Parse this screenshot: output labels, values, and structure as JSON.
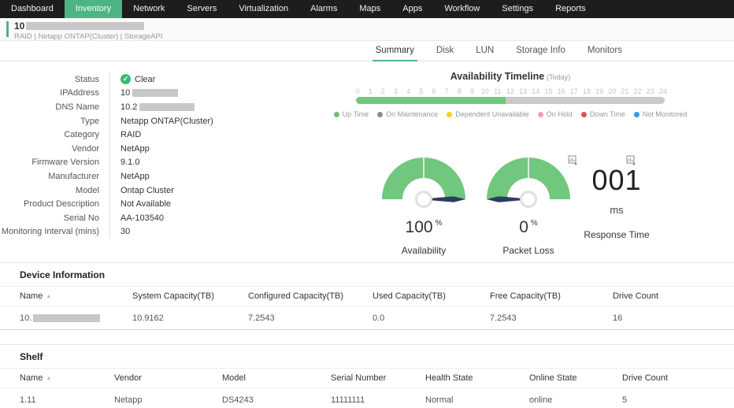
{
  "nav": {
    "items": [
      {
        "label": "Dashboard"
      },
      {
        "label": "Inventory"
      },
      {
        "label": "Network"
      },
      {
        "label": "Servers"
      },
      {
        "label": "Virtualization"
      },
      {
        "label": "Alarms"
      },
      {
        "label": "Maps"
      },
      {
        "label": "Apps"
      },
      {
        "label": "Workflow"
      },
      {
        "label": "Settings"
      },
      {
        "label": "Reports"
      }
    ]
  },
  "header": {
    "title_prefix": "10",
    "subtitle": "RAID | Netapp ONTAP(Cluster)  | StorageAPI"
  },
  "tabs": {
    "items": [
      {
        "label": "Summary",
        "active": true
      },
      {
        "label": "Disk",
        "active": false
      },
      {
        "label": "LUN",
        "active": false
      },
      {
        "label": "Storage Info",
        "active": false
      },
      {
        "label": "Monitors",
        "active": false
      }
    ]
  },
  "details": {
    "rows": [
      {
        "label": "Status",
        "value": "Clear"
      },
      {
        "label": "IPAddress",
        "value": "10"
      },
      {
        "label": "DNS Name",
        "value": "10.2"
      },
      {
        "label": "Type",
        "value": "Netapp ONTAP(Cluster)"
      },
      {
        "label": "Category",
        "value": "RAID"
      },
      {
        "label": "Vendor",
        "value": "NetApp"
      },
      {
        "label": "Firmware Version",
        "value": "9.1.0"
      },
      {
        "label": "Manufacturer",
        "value": "NetApp"
      },
      {
        "label": "Model",
        "value": "Ontap Cluster"
      },
      {
        "label": "Product Description",
        "value": "Not Available"
      },
      {
        "label": "Serial No",
        "value": "AA-103540"
      },
      {
        "label": "Monitoring Interval (mins)",
        "value": "30"
      }
    ]
  },
  "timeline": {
    "title": "Availability Timeline",
    "subtitle": "(Today)",
    "hours": [
      "0",
      "1",
      "2",
      "3",
      "4",
      "5",
      "6",
      "7",
      "8",
      "9",
      "10",
      "11",
      "12",
      "13",
      "14",
      "15",
      "16",
      "17",
      "18",
      "19",
      "20",
      "21",
      "22",
      "23",
      "24"
    ],
    "uptime_percent": 48.5,
    "legend": [
      {
        "label": "Up Time",
        "color": "#6dbf74"
      },
      {
        "label": "On Maintenance",
        "color": "#8c8c8c"
      },
      {
        "label": "Dependent Unavailable",
        "color": "#f6d416"
      },
      {
        "label": "On Hold",
        "color": "#f2a0a6"
      },
      {
        "label": "Down Time",
        "color": "#e4504e"
      },
      {
        "label": "Not Monitored",
        "color": "#2f9fe0"
      }
    ]
  },
  "gauges": {
    "availability": {
      "value": "100",
      "unit": "%",
      "label": "Availability",
      "percent": 100
    },
    "packet_loss": {
      "value": "0",
      "unit": "%",
      "label": "Packet Loss",
      "percent": 0
    },
    "response_time": {
      "value": "001",
      "unit": "ms",
      "label": "Response Time"
    }
  },
  "device_information": {
    "title": "Device Information",
    "columns": [
      "Name",
      "System Capacity(TB)",
      "Configured Capacity(TB)",
      "Used Capacity(TB)",
      "Free Capacity(TB)",
      "Drive Count"
    ],
    "row": {
      "name_prefix": "10.",
      "system_capacity": "10.9162",
      "configured_capacity": "7.2543",
      "used_capacity": "0.0",
      "free_capacity": "7.2543",
      "drive_count": "16"
    }
  },
  "shelf": {
    "title": "Shelf",
    "columns": [
      "Name",
      "Vendor",
      "Model",
      "Serial Number",
      "Health State",
      "Online State",
      "Drive Count"
    ],
    "row": {
      "name": "1.11",
      "vendor": "Netapp",
      "model": "DS4243",
      "serial_number": "11111111",
      "health_state": "Normal",
      "online_state": "online",
      "drive_count": "5"
    }
  },
  "colors": {
    "accent_green": "#4cb583",
    "gauge_green": "#72c77e",
    "nav_dark": "#1d1d1d",
    "status_clear_green": "#3cb878"
  }
}
